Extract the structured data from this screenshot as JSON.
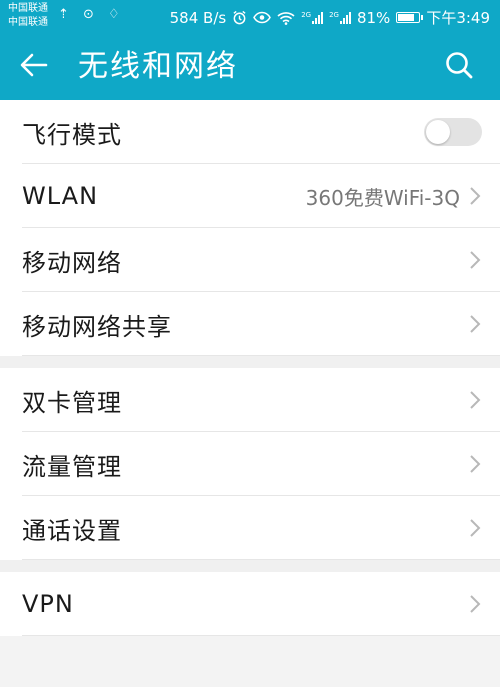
{
  "status_bar": {
    "carrier_1": "中国联通",
    "carrier_2": "中国联通",
    "left_icons": "⇡ ⊙ ♢",
    "speed": "584 B/s",
    "alarm_icon": "alarm-icon",
    "eye_icon": "eye-icon",
    "wifi_icon": "wifi-icon",
    "network_2g_1": "2G",
    "network_2g_2": "2G",
    "battery_percent": "81%",
    "battery_level": 81,
    "time": "下午3:49"
  },
  "app_bar": {
    "title": "无线和网络",
    "back_icon": "arrow-left-icon",
    "search_icon": "search-icon",
    "color": "#0fa8c7"
  },
  "groups": [
    {
      "items": [
        {
          "label": "飞行模式",
          "type": "toggle",
          "on": false
        },
        {
          "label": "WLAN",
          "value": "360免费WiFi-3Q",
          "type": "nav"
        },
        {
          "label": "移动网络",
          "type": "nav"
        },
        {
          "label": "移动网络共享",
          "type": "nav"
        }
      ]
    },
    {
      "items": [
        {
          "label": "双卡管理",
          "type": "nav"
        },
        {
          "label": "流量管理",
          "type": "nav"
        },
        {
          "label": "通话设置",
          "type": "nav"
        }
      ]
    },
    {
      "items": [
        {
          "label": "VPN",
          "type": "nav"
        }
      ]
    }
  ]
}
